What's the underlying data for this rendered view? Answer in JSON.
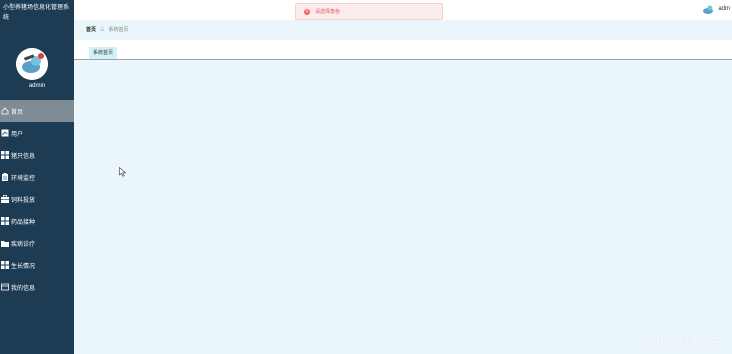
{
  "sidebar": {
    "system_title": "小型养猪场信息化管理系统",
    "user_name": "admin",
    "items": [
      {
        "label": "首页",
        "icon": "home-icon",
        "active": true
      },
      {
        "label": "用户",
        "icon": "user-icon",
        "active": false
      },
      {
        "label": "猪只信息",
        "icon": "grid-icon",
        "active": false
      },
      {
        "label": "环境监控",
        "icon": "clipboard-icon",
        "active": false
      },
      {
        "label": "饲料投放",
        "icon": "briefcase-icon",
        "active": false
      },
      {
        "label": "药品接种",
        "icon": "grid-icon",
        "active": false
      },
      {
        "label": "疾病诊疗",
        "icon": "folder-icon",
        "active": false
      },
      {
        "label": "生长情况",
        "icon": "grid-icon",
        "active": false
      },
      {
        "label": "我的信息",
        "icon": "card-icon",
        "active": false
      }
    ]
  },
  "alert": {
    "text": "请选择角色"
  },
  "header": {
    "user_name": "adm"
  },
  "breadcrumb": {
    "home": "首页",
    "current": "系统首页"
  },
  "tabs": [
    {
      "label": "系统首页"
    }
  ],
  "watermark": "CSDN @茹茹学姐",
  "colors": {
    "sidebar": "#1d3b53",
    "active_item": "#7f8c96",
    "content_bg": "#eaf6fc",
    "tab_bg": "#d4f1f9",
    "alert_text": "#e05c5c"
  }
}
